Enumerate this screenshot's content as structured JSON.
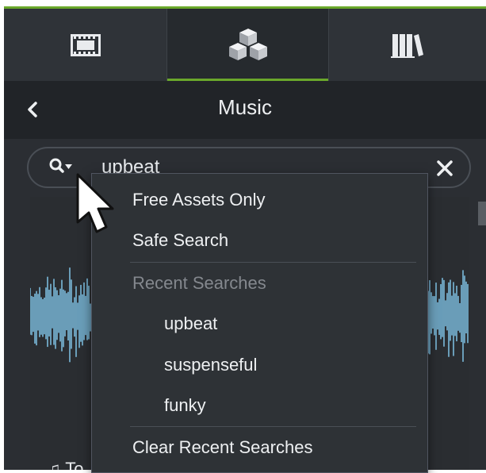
{
  "tabs": [
    {
      "icon": "film-strip-icon"
    },
    {
      "icon": "cubes-icon",
      "active": true
    },
    {
      "icon": "library-books-icon"
    }
  ],
  "header": {
    "title": "Music",
    "back_icon": "chevron-left-icon"
  },
  "search": {
    "value": "upbeat",
    "options_icon": "search-options-icon",
    "clear_icon": "close-icon"
  },
  "dropdown": {
    "free_assets": "Free Assets Only",
    "safe_search": "Safe Search",
    "recent_heading": "Recent Searches",
    "recent": [
      "upbeat",
      "suspenseful",
      "funky"
    ],
    "clear_recent": "Clear Recent Searches"
  },
  "asset": {
    "label_partial": "To",
    "icon": "music-note-icon"
  },
  "colors": {
    "accent": "#6aa82b",
    "panel": "#2b2e33",
    "waveform": "#7fc3e6"
  }
}
